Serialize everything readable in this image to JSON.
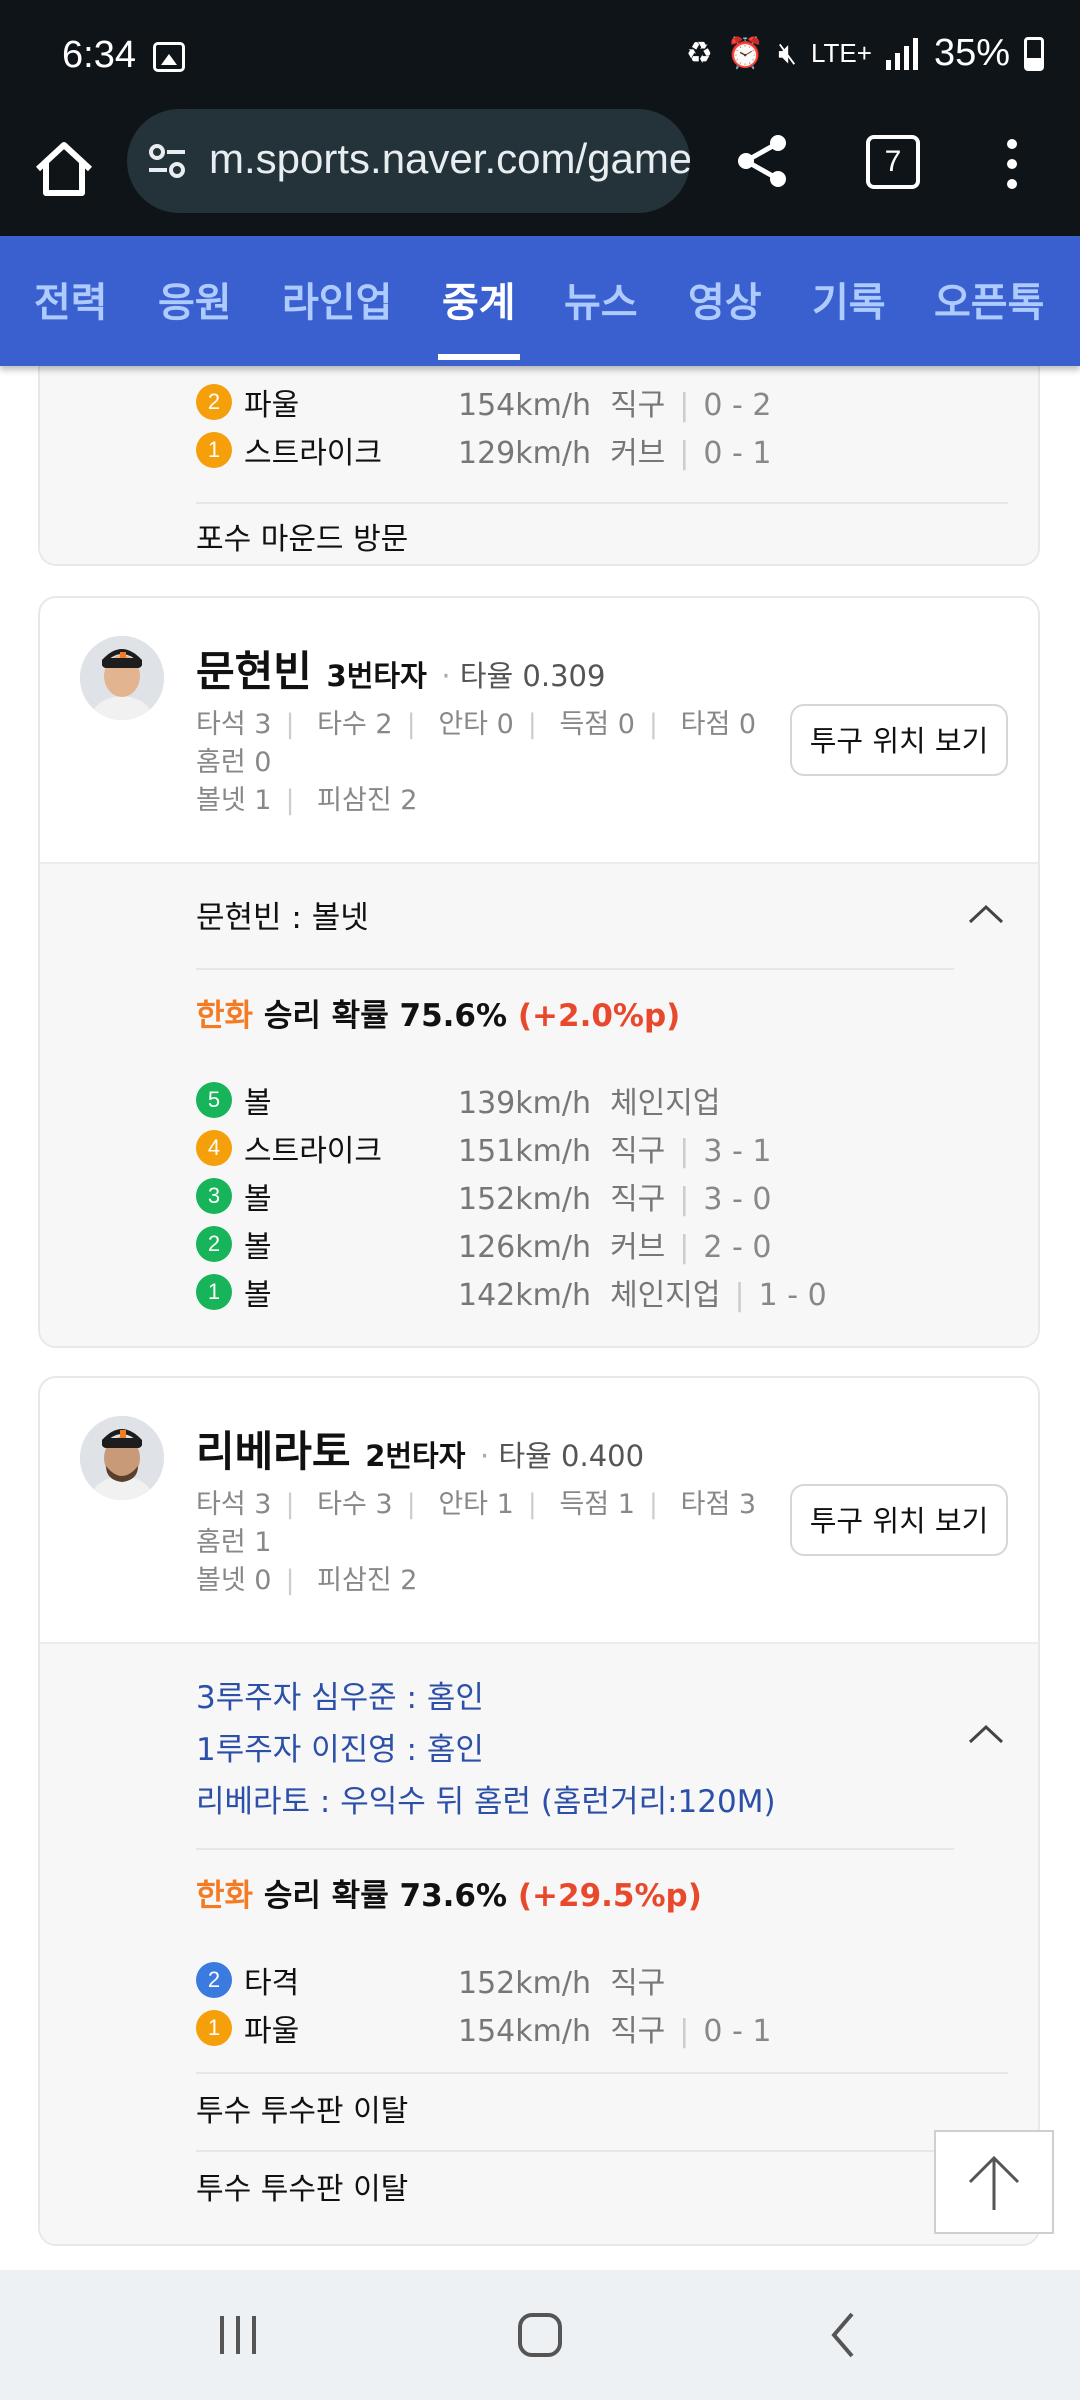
{
  "status_bar": {
    "time": "6:34",
    "network": "LTE+",
    "battery": "35%"
  },
  "browser": {
    "url": "m.sports.naver.com/game",
    "tab_count": "7"
  },
  "nav_tabs": [
    {
      "label": "전력"
    },
    {
      "label": "응원"
    },
    {
      "label": "라인업"
    },
    {
      "label": "중계",
      "active": true
    },
    {
      "label": "뉴스"
    },
    {
      "label": "영상"
    },
    {
      "label": "기록"
    },
    {
      "label": "오픈톡"
    }
  ],
  "card0": {
    "pitches": [
      {
        "num": "2",
        "result": "파울",
        "speed": "154km/h",
        "type": "직구",
        "count": "0 - 2",
        "color": "#f5a00b"
      },
      {
        "num": "1",
        "result": "스트라이크",
        "speed": "129km/h",
        "type": "커브",
        "count": "0 - 1",
        "color": "#f5a00b"
      }
    ],
    "event": "포수 마운드 방문"
  },
  "batters": [
    {
      "name": "문현빈",
      "order": "3번타자",
      "avg_label": "타율 0.309",
      "stats_line1": [
        "타석 3",
        "타수 2",
        "안타 0",
        "득점 0",
        "타점 0"
      ],
      "stats_line2": "홈런 0",
      "stats_line3": [
        "볼넷 1",
        "피삼진 2"
      ],
      "location_button": "투구 위치 보기",
      "results": [
        "문현빈 : 볼넷"
      ],
      "win_team": "한화",
      "win_text": "승리 확률 75.6%",
      "win_delta": "(+2.0%p)",
      "pitches": [
        {
          "num": "5",
          "result": "볼",
          "speed": "139km/h",
          "type": "체인지업",
          "count": "",
          "color": "#17b45a"
        },
        {
          "num": "4",
          "result": "스트라이크",
          "speed": "151km/h",
          "type": "직구",
          "count": "3 - 1",
          "color": "#f5a00b"
        },
        {
          "num": "3",
          "result": "볼",
          "speed": "152km/h",
          "type": "직구",
          "count": "3 - 0",
          "color": "#17b45a"
        },
        {
          "num": "2",
          "result": "볼",
          "speed": "126km/h",
          "type": "커브",
          "count": "2 - 0",
          "color": "#17b45a"
        },
        {
          "num": "1",
          "result": "볼",
          "speed": "142km/h",
          "type": "체인지업",
          "count": "1 - 0",
          "color": "#17b45a"
        }
      ]
    },
    {
      "name": "리베라토",
      "order": "2번타자",
      "avg_label": "타율 0.400",
      "stats_line1": [
        "타석 3",
        "타수 3",
        "안타 1",
        "득점 1",
        "타점 3"
      ],
      "stats_line2": "홈런 1",
      "stats_line3": [
        "볼넷 0",
        "피삼진 2"
      ],
      "location_button": "투구 위치 보기",
      "results": [
        "3루주자 심우준 : 홈인",
        "1루주자 이진영 : 홈인",
        "리베라토 : 우익수 뒤 홈런 (홈런거리:120M)"
      ],
      "win_team": "한화",
      "win_text": "승리 확률 73.6%",
      "win_delta": "(+29.5%p)",
      "pitches": [
        {
          "num": "2",
          "result": "타격",
          "speed": "152km/h",
          "type": "직구",
          "count": "",
          "color": "#3b7be0"
        },
        {
          "num": "1",
          "result": "파울",
          "speed": "154km/h",
          "type": "직구",
          "count": "0 - 1",
          "color": "#f5a00b"
        }
      ],
      "events": [
        "투수 투수판 이탈",
        "투수 투수판 이탈"
      ]
    }
  ],
  "colors": {
    "nav_bg": "#3a5fcf",
    "team_orange": "#f37b23",
    "delta_red": "#e8492d",
    "result_blue": "#2c4fa8"
  },
  "icons": [
    "home-icon",
    "tune-icon",
    "share-icon",
    "tabs-icon",
    "more-vert-icon",
    "chevron-up-icon",
    "arrow-up-icon",
    "recents-icon",
    "home-nav-icon",
    "back-icon"
  ]
}
